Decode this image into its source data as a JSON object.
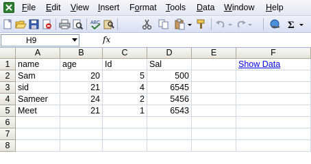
{
  "menu": [
    "File",
    "Edit",
    "View",
    "Insert",
    "Format",
    "Tools",
    "Data",
    "Window",
    "Help"
  ],
  "menu_underline_index": [
    0,
    0,
    0,
    0,
    1,
    0,
    0,
    0,
    0
  ],
  "toolbar": {
    "icons": [
      "new-icon",
      "open-icon",
      "save-icon",
      "permission-icon",
      "print-icon",
      "print-preview-icon",
      "spelling-icon",
      "research-icon",
      "cut-icon",
      "copy-icon",
      "paste-icon",
      "format-painter-icon",
      "undo-icon",
      "redo-icon",
      "hyperlink-icon",
      "autosum-icon"
    ]
  },
  "formula_bar": {
    "name_box": "H9",
    "fx_label": "fx",
    "formula": ""
  },
  "sheet": {
    "columns": [
      "A",
      "B",
      "C",
      "D",
      "E",
      "F"
    ],
    "rows": [
      "1",
      "2",
      "3",
      "4",
      "5",
      "6",
      "7",
      "8"
    ],
    "cells": [
      [
        "name",
        "age",
        "Id",
        "Sal",
        "",
        "Show Data"
      ],
      [
        "Sam",
        "20",
        "5",
        "500",
        "",
        ""
      ],
      [
        "sid",
        "21",
        "4",
        "6545",
        "",
        ""
      ],
      [
        "Sameer",
        "24",
        "2",
        "5456",
        "",
        ""
      ],
      [
        "Meet",
        "21",
        "1",
        "6543",
        "",
        ""
      ],
      [
        "",
        "",
        "",
        "",
        "",
        ""
      ],
      [
        "",
        "",
        "",
        "",
        "",
        ""
      ],
      [
        "",
        "",
        "",
        "",
        "",
        ""
      ]
    ]
  },
  "colors": {
    "link": "#0000ff",
    "gridline": "#d0d7e5",
    "header_bg": "#ece9d8"
  }
}
